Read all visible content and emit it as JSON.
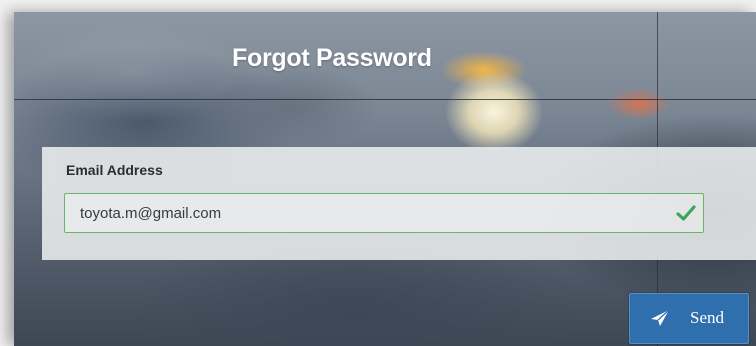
{
  "form": {
    "title": "Forgot Password",
    "email_label": "Email Address",
    "email_value": "toyota.m@gmail.com",
    "email_valid": true,
    "send_label": "Send"
  },
  "icons": {
    "valid": "checkmark-icon",
    "send": "paper-plane-icon"
  },
  "colors": {
    "valid_border": "#6bb56b",
    "check": "#3aa55a",
    "button": "#2f6fad"
  }
}
